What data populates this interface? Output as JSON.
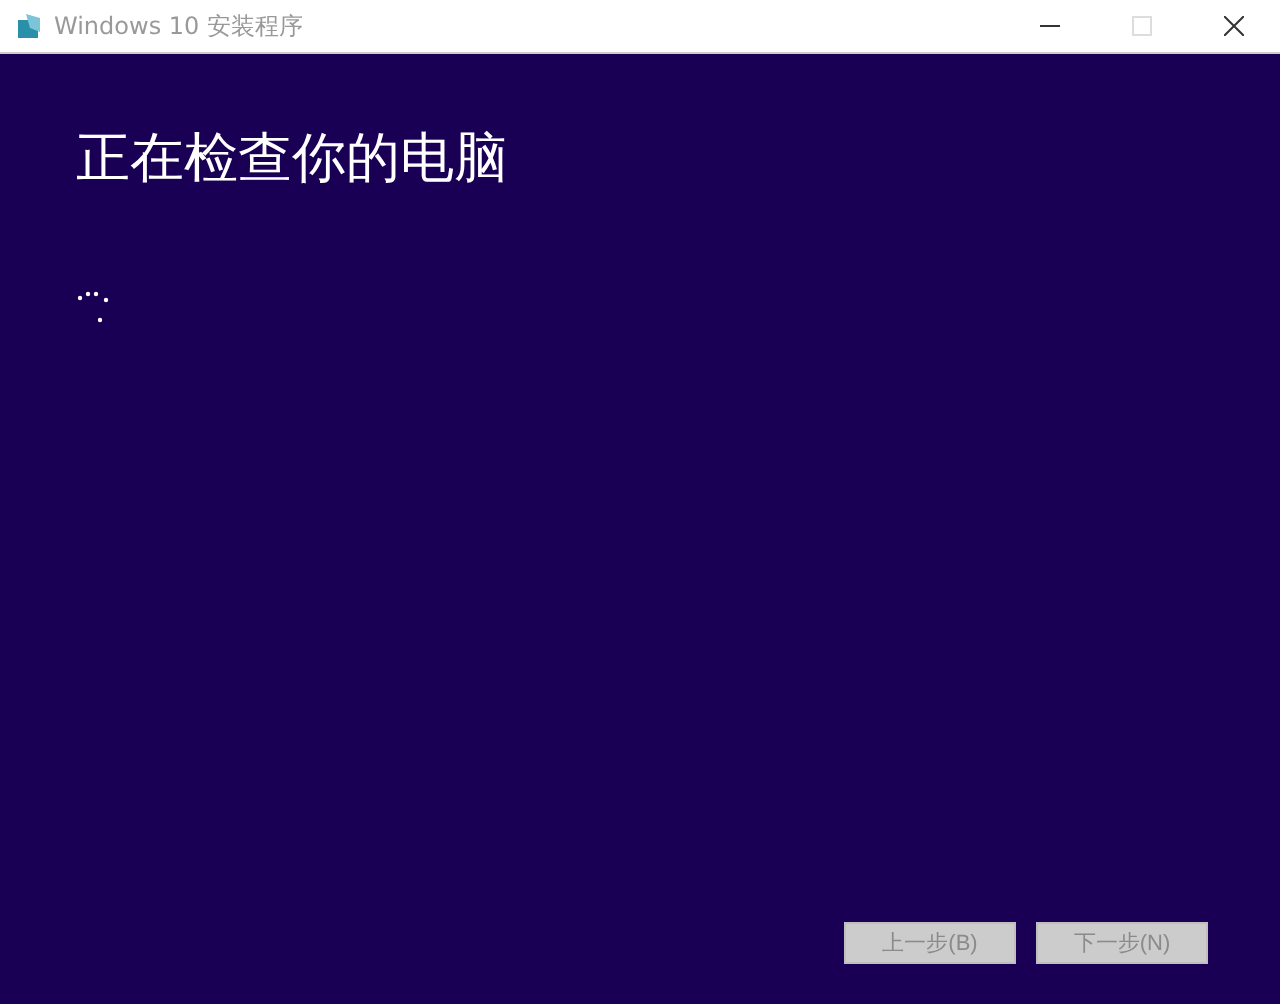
{
  "window": {
    "title": "Windows 10 安装程序",
    "maximize_disabled": true
  },
  "heading": "正在检查你的电脑",
  "buttons": [
    {
      "label": "上一步(B)",
      "disabled": true
    },
    {
      "label": "下一步(N)",
      "disabled": true
    }
  ]
}
